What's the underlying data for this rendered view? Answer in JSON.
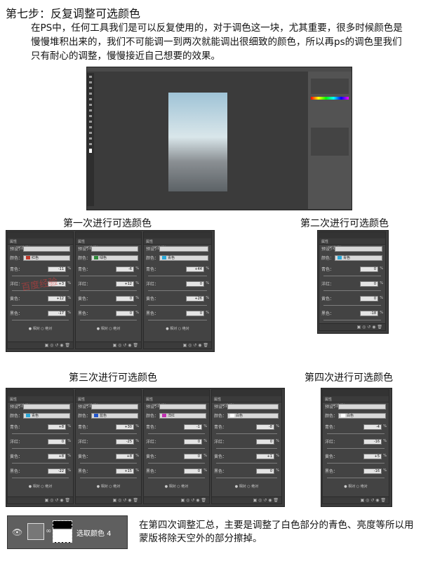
{
  "step_title": "第七步：反复调整可选颜色",
  "intro": "在PS中，任何工具我们是可以反复使用的，对于调色这一块，尤其重要，很多时候颜色是慢慢堆积出来的，我们不可能调一到两次就能调出很细致的颜色，所以再ps的调色里我们只有耐心的调整，慢慢接近自己想要的效果。",
  "sections": {
    "first": "第一次进行可选颜色",
    "second": "第二次进行可选颜色",
    "third": "第三次进行可选颜色",
    "fourth": "第四次进行可选颜色"
  },
  "watermark": "百度经验",
  "panel_common": {
    "preset_label": "预设：",
    "colors_label": "颜色：",
    "cyan": "青色：",
    "magenta": "洋红：",
    "yellow": "黄色：",
    "black": "黑色：",
    "pct": "%",
    "radio": "● 相对  ○ 绝对",
    "header": "属性",
    "subhead": "可选颜色"
  },
  "first_panels": [
    {
      "color": "红色",
      "swatch": "#c0392b",
      "vals": [
        "-11",
        "+3",
        "+12",
        "-17"
      ]
    },
    {
      "color": "绿色",
      "swatch": "#2e8b3a",
      "vals": [
        "-6",
        "+12",
        "0",
        "0"
      ]
    },
    {
      "color": "青色",
      "swatch": "#2aa8d8",
      "vals": [
        "+44",
        "0",
        "+26",
        "0"
      ]
    }
  ],
  "second_panel": {
    "color": "青色",
    "swatch": "#2aa8d8",
    "vals": [
      "0",
      "0",
      "0",
      "-18"
    ]
  },
  "third_panels": [
    {
      "color": "青色",
      "swatch": "#2aa8d8",
      "vals": [
        "+8",
        "0",
        "+8",
        "-22"
      ]
    },
    {
      "color": "蓝色",
      "swatch": "#2255cc",
      "vals": [
        "+30",
        "-25",
        "+8",
        "+15"
      ]
    },
    {
      "color": "洋红",
      "swatch": "#c02fb0",
      "vals": [
        "-1",
        "0",
        "0",
        "0"
      ]
    },
    {
      "color": "白色",
      "swatch": "#ffffff",
      "vals": [
        "-8",
        "0",
        "+1",
        "0"
      ]
    }
  ],
  "fourth_panel": {
    "color": "白色",
    "swatch": "#ffffff",
    "vals": [
      "-4",
      "-16",
      "+5",
      "-16"
    ]
  },
  "layer": {
    "name": "选取颜色 4",
    "eye": "👁"
  },
  "summary": "在第四次调整汇总，主要是调整了白色部分的青色、亮度等所以用蒙版将除天空外的部分擦掉。"
}
